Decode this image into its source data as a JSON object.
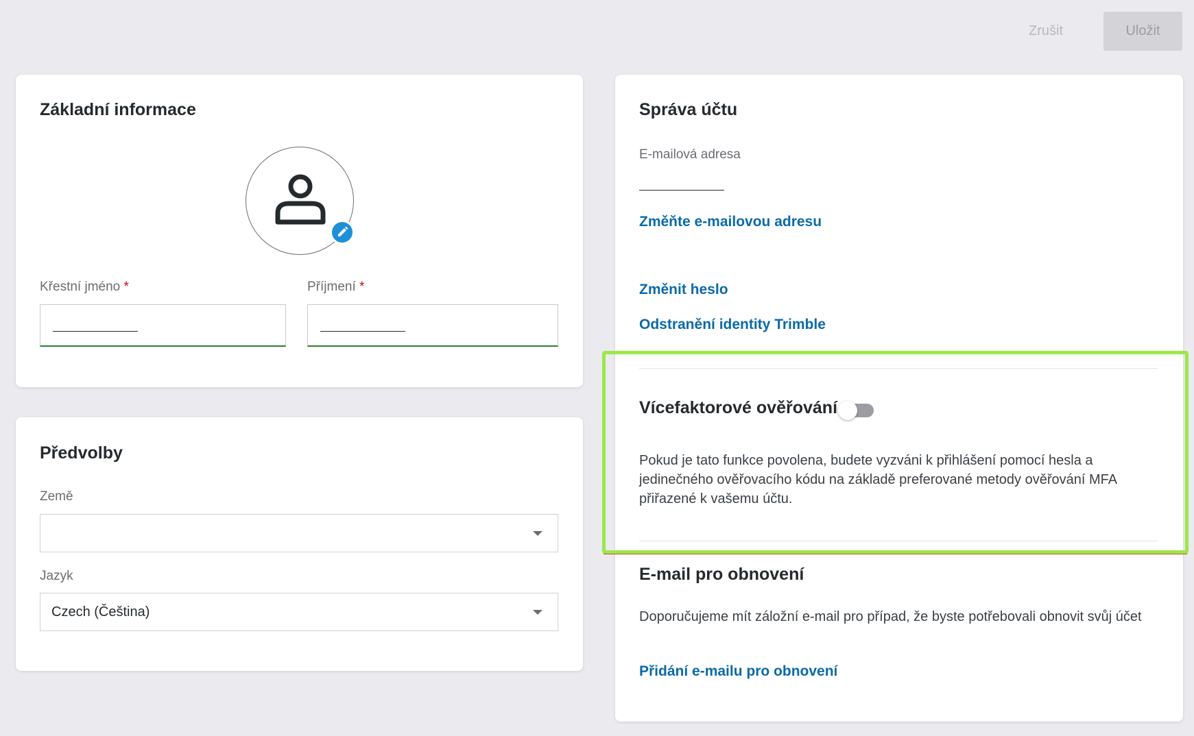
{
  "header": {
    "cancel_label": "Zrušit",
    "save_label": "Uložit"
  },
  "basic_info": {
    "title": "Základní informace",
    "first_name": {
      "label": "Křestní jméno",
      "required_mark": "*",
      "value": ""
    },
    "last_name": {
      "label": "Příjmení",
      "required_mark": "*",
      "value": ""
    },
    "avatar_icon": "person-icon",
    "edit_icon": "pencil-icon"
  },
  "preferences": {
    "title": "Předvolby",
    "country": {
      "label": "Země",
      "value": ""
    },
    "language": {
      "label": "Jazyk",
      "value": "Czech (Čeština)"
    }
  },
  "account": {
    "title": "Správa účtu",
    "email_label": "E-mailová adresa",
    "email_value": "",
    "change_email_link": "Změňte e-mailovou adresu",
    "change_password_link": "Změnit heslo",
    "remove_identity_link": "Odstranění identity Trimble",
    "mfa": {
      "title": "Vícefaktorové ověřování",
      "enabled": false,
      "description": "Pokud je tato funkce povolena, budete vyzváni k přihlášení pomocí hesla a jedinečného ověřovacího kódu na základě preferované metody ověřování MFA přiřazené k vašemu účtu."
    },
    "recovery": {
      "title": "E-mail pro obnovení",
      "description": "Doporučujeme mít záložní e-mail pro případ, že byste potřebovali obnovit svůj účet",
      "add_link": "Přidání e-mailu pro obnovení"
    }
  },
  "colors": {
    "link": "#0a6aa8",
    "highlight": "#9be84a",
    "input_focus_border": "#2e7d32",
    "edit_badge": "#1e8fd8"
  }
}
